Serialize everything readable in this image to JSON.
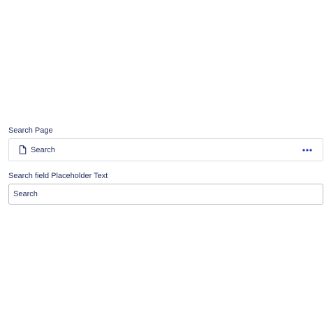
{
  "search_page": {
    "label": "Search Page",
    "page_name": "Search",
    "page_icon": "file-icon",
    "more_icon": "more-horizontal-icon"
  },
  "placeholder_field": {
    "label": "Search field Placeholder Text",
    "value": "Search"
  },
  "colors": {
    "text": "#1e2a5a",
    "accent": "#1f36c7",
    "border": "#d9dbe3"
  }
}
